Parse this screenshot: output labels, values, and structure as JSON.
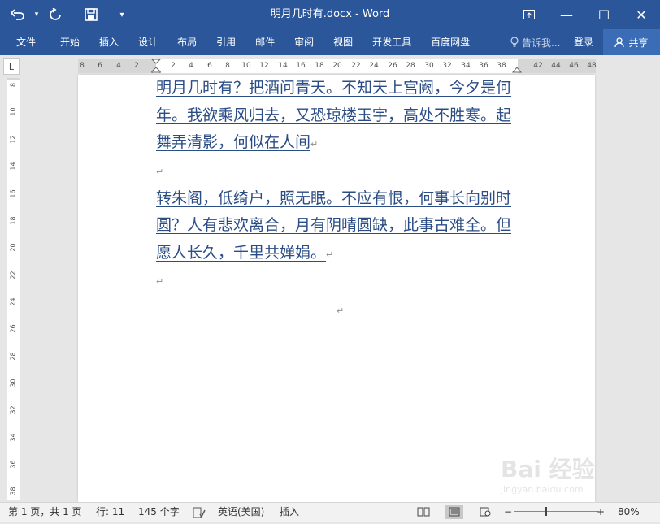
{
  "titlebar": {
    "title": "明月几时有.docx - Word",
    "undo_icon": "undo-icon",
    "redo_icon": "redo-icon",
    "save_icon": "save-icon",
    "customize_label": "▾",
    "ribbon_display_icon": "ribbon-display-icon",
    "minimize_label": "—",
    "maximize_label": "☐",
    "close_label": "✕"
  },
  "ribbon": {
    "tabs": [
      "文件",
      "开始",
      "插入",
      "设计",
      "布局",
      "引用",
      "邮件",
      "审阅",
      "视图",
      "开发工具",
      "百度网盘"
    ],
    "tell_me": "告诉我...",
    "login": "登录",
    "share": "共享"
  },
  "ruler": {
    "corner_label": "L",
    "h_ticks": [
      "8",
      "6",
      "4",
      "2",
      "2",
      "4",
      "6",
      "8",
      "10",
      "12",
      "14",
      "16",
      "18",
      "20",
      "22",
      "24",
      "26",
      "28",
      "30",
      "32",
      "34",
      "36",
      "38",
      "42",
      "44",
      "46",
      "48"
    ],
    "v_ticks": [
      "8",
      "10",
      "12",
      "14",
      "16",
      "18",
      "20",
      "22",
      "24",
      "26",
      "28",
      "30",
      "32",
      "34",
      "36",
      "38"
    ]
  },
  "document": {
    "paragraph1": "明月几时有？把酒问青天。不知天上宫阙，今夕是何年。我欲乘风归去，又恐琼楼玉宇，高处不胜寒。起舞弄清影，何似在人间",
    "paragraph2": "转朱阁，低绮户，照无眠。不应有恨，何事长向别时圆？人有悲欢离合，月有阴晴圆缺，此事古难全。但愿人长久，千里共婵娟。",
    "para_mark": "↵"
  },
  "statusbar": {
    "page": "第 1 页，共 1 页",
    "lines": "行: 11",
    "words": "145 个字",
    "language": "英语(美国)",
    "mode": "插入",
    "zoom_minus": "−",
    "zoom_plus": "+",
    "zoom": "80%"
  },
  "watermark": {
    "text": "Bai 经验",
    "sub": "jingyan.baidu.com"
  },
  "colors": {
    "titlebar": "#2b579a",
    "text": "#2b4d86",
    "statusbar": "#f2f2f2"
  }
}
